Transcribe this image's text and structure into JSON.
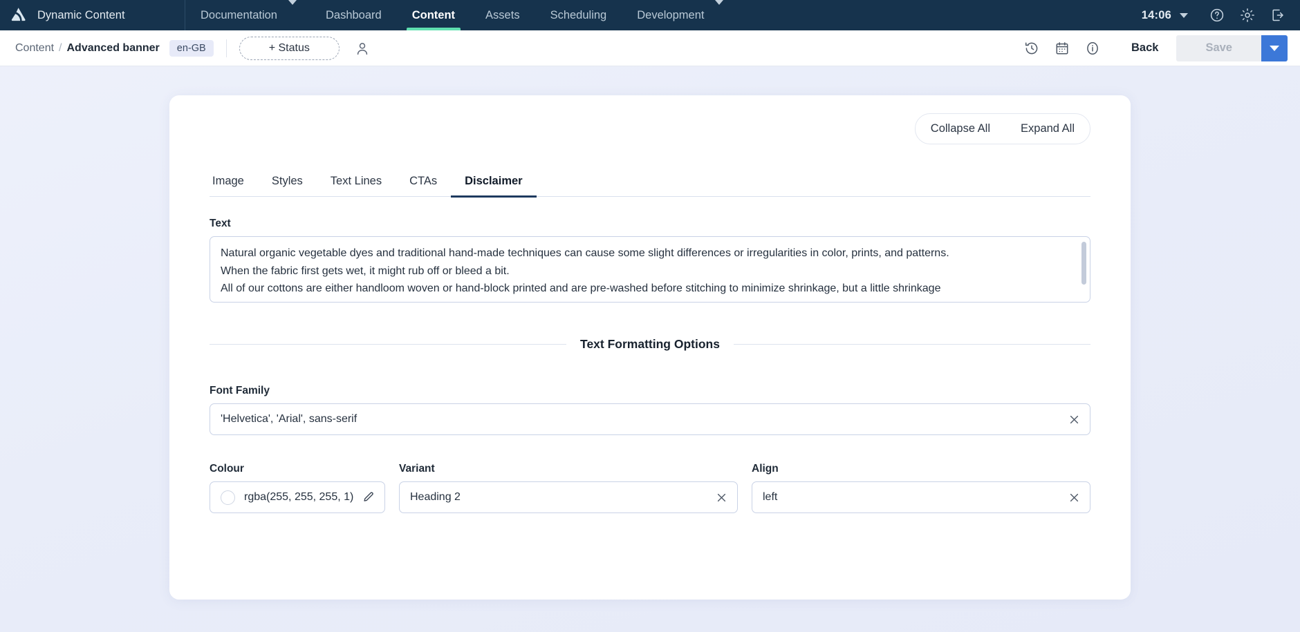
{
  "topnav": {
    "brand": "Dynamic Content",
    "logo_icon": "dynamic-content-logo",
    "items": [
      {
        "label": "Documentation",
        "active": false,
        "caret": true
      },
      {
        "label": "Dashboard",
        "active": false,
        "caret": false
      },
      {
        "label": "Content",
        "active": true,
        "caret": false
      },
      {
        "label": "Assets",
        "active": false,
        "caret": false
      },
      {
        "label": "Scheduling",
        "active": false,
        "caret": false
      },
      {
        "label": "Development",
        "active": false,
        "caret": true
      }
    ],
    "time": "14:06",
    "time_caret_icon": "chevron-down-icon",
    "help_icon": "help-circle-icon",
    "settings_icon": "gear-icon",
    "logout_icon": "logout-icon",
    "accent_active": "#5fe0b0",
    "background": "#16334d"
  },
  "toolbar": {
    "breadcrumb_root": "Content",
    "breadcrumb_separator": "/",
    "breadcrumb_current": "Advanced banner",
    "locale_badge": "en-GB",
    "status_button": "+ Status",
    "assignee_icon": "person-icon",
    "history_icon": "history-icon",
    "calendar_icon": "calendar-icon",
    "info_icon": "info-icon",
    "back_button": "Back",
    "save_button": "Save",
    "save_caret_icon": "chevron-down-icon",
    "save_accent": "#3c78d8"
  },
  "card": {
    "collapse_all": "Collapse All",
    "expand_all": "Expand All",
    "tabs": [
      {
        "label": "Image",
        "active": false
      },
      {
        "label": "Styles",
        "active": false
      },
      {
        "label": "Text Lines",
        "active": false
      },
      {
        "label": "CTAs",
        "active": false
      },
      {
        "label": "Disclaimer",
        "active": true
      }
    ],
    "text_field": {
      "label": "Text",
      "lines": [
        "Natural organic vegetable dyes and traditional hand-made techniques can cause some slight differences or irregularities in color, prints, and patterns.",
        "When the fabric first gets wet, it might rub off or bleed a bit.",
        "All of our cottons are either handloom woven or hand-block printed and are pre-washed before stitching to minimize shrinkage, but a little shrinkage"
      ]
    },
    "section_title": "Text Formatting Options",
    "font_family": {
      "label": "Font Family",
      "value": "'Helvetica', 'Arial', sans-serif",
      "clear_icon": "close-icon"
    },
    "colour": {
      "label": "Colour",
      "value": "rgba(255, 255, 255, 1)",
      "swatch_hex": "#ffffff",
      "edit_icon": "pencil-icon"
    },
    "variant": {
      "label": "Variant",
      "value": "Heading 2",
      "clear_icon": "close-icon"
    },
    "align": {
      "label": "Align",
      "value": "left",
      "clear_icon": "close-icon"
    }
  }
}
